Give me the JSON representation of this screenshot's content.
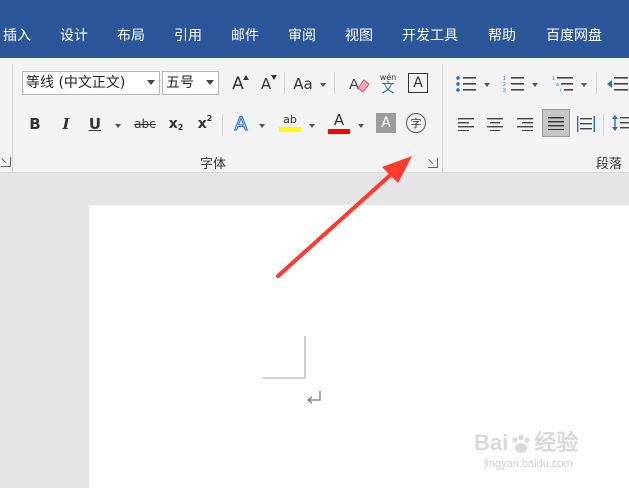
{
  "tabs": [
    "插入",
    "设计",
    "布局",
    "引用",
    "邮件",
    "审阅",
    "视图",
    "开发工具",
    "帮助",
    "百度网盘"
  ],
  "font": {
    "name_value": "等线 (中文正文)",
    "size_value": "五号",
    "group_label": "字体",
    "grow_icon": "A",
    "shrink_icon": "A",
    "case_icon": "Aa",
    "phonetic_top": "wén",
    "phonetic_bottom": "文",
    "border_char": "A",
    "bold": "B",
    "italic": "I",
    "underline": "U",
    "strike": "abc",
    "subscript_base": "x",
    "subscript_sub": "2",
    "superscript_base": "x",
    "superscript_sup": "2",
    "effects": "A",
    "highlight": "ab",
    "font_color": "A",
    "shading": "A",
    "enclose_char": "字"
  },
  "paragraph": {
    "group_label": "段落"
  },
  "colors": {
    "tab_bar": "#2b579a",
    "highlight_bar": "#ffff00",
    "font_color_bar": "#ff0000",
    "arrow": "#ff3b2f"
  },
  "watermark": {
    "brand": "Bai",
    "brand_tail": "经验",
    "url": "jingyan.baidu.com"
  }
}
